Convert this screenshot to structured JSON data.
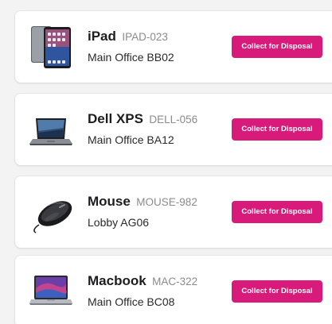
{
  "accent_color": "#d81b7a",
  "items": [
    {
      "name": "iPad",
      "code": "IPAD-023",
      "location": "Main Office BB02",
      "action_label": "Collect for Disposal",
      "icon": "ipad-image"
    },
    {
      "name": "Dell XPS",
      "code": "DELL-056",
      "location": "Main Office BA12",
      "action_label": "Collect for Disposal",
      "icon": "laptop-image"
    },
    {
      "name": "Mouse",
      "code": "MOUSE-982",
      "location": "Lobby AG06",
      "action_label": "Collect for Disposal",
      "icon": "mouse-image"
    },
    {
      "name": "Macbook",
      "code": "MAC-322",
      "location": "Main Office BC08",
      "action_label": "Collect for Disposal",
      "icon": "macbook-image"
    }
  ]
}
